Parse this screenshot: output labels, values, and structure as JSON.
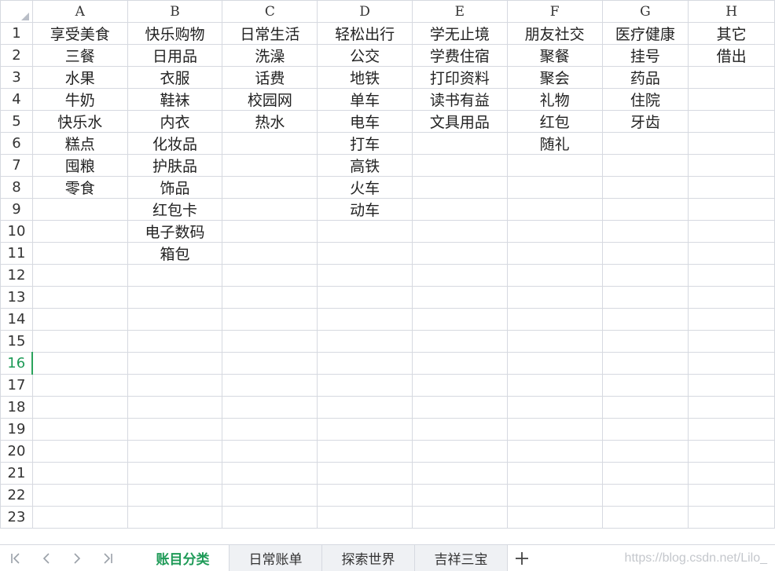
{
  "sheet": {
    "columns": [
      "A",
      "B",
      "C",
      "D",
      "E",
      "F",
      "G",
      "H"
    ],
    "active_row": 16,
    "rows": [
      {
        "num": "1",
        "cells": [
          "享受美食",
          "快乐购物",
          "日常生活",
          "轻松出行",
          "学无止境",
          "朋友社交",
          "医疗健康",
          "其它"
        ]
      },
      {
        "num": "2",
        "cells": [
          "三餐",
          "日用品",
          "洗澡",
          "公交",
          "学费住宿",
          "聚餐",
          "挂号",
          "借出"
        ]
      },
      {
        "num": "3",
        "cells": [
          "水果",
          "衣服",
          "话费",
          "地铁",
          "打印资料",
          "聚会",
          "药品",
          ""
        ]
      },
      {
        "num": "4",
        "cells": [
          "牛奶",
          "鞋袜",
          "校园网",
          "单车",
          "读书有益",
          "礼物",
          "住院",
          ""
        ]
      },
      {
        "num": "5",
        "cells": [
          "快乐水",
          "内衣",
          "热水",
          "电车",
          "文具用品",
          "红包",
          "牙齿",
          ""
        ]
      },
      {
        "num": "6",
        "cells": [
          "糕点",
          "化妆品",
          "",
          "打车",
          "",
          "随礼",
          "",
          ""
        ]
      },
      {
        "num": "7",
        "cells": [
          "囤粮",
          "护肤品",
          "",
          "高铁",
          "",
          "",
          "",
          ""
        ]
      },
      {
        "num": "8",
        "cells": [
          "零食",
          "饰品",
          "",
          "火车",
          "",
          "",
          "",
          ""
        ]
      },
      {
        "num": "9",
        "cells": [
          "",
          "红包卡",
          "",
          "动车",
          "",
          "",
          "",
          ""
        ]
      },
      {
        "num": "10",
        "cells": [
          "",
          "电子数码",
          "",
          "",
          "",
          "",
          "",
          ""
        ]
      },
      {
        "num": "11",
        "cells": [
          "",
          "箱包",
          "",
          "",
          "",
          "",
          "",
          ""
        ]
      },
      {
        "num": "12",
        "cells": [
          "",
          "",
          "",
          "",
          "",
          "",
          "",
          ""
        ]
      },
      {
        "num": "13",
        "cells": [
          "",
          "",
          "",
          "",
          "",
          "",
          "",
          ""
        ]
      },
      {
        "num": "14",
        "cells": [
          "",
          "",
          "",
          "",
          "",
          "",
          "",
          ""
        ]
      },
      {
        "num": "15",
        "cells": [
          "",
          "",
          "",
          "",
          "",
          "",
          "",
          ""
        ]
      },
      {
        "num": "16",
        "cells": [
          "",
          "",
          "",
          "",
          "",
          "",
          "",
          ""
        ]
      },
      {
        "num": "17",
        "cells": [
          "",
          "",
          "",
          "",
          "",
          "",
          "",
          ""
        ]
      },
      {
        "num": "18",
        "cells": [
          "",
          "",
          "",
          "",
          "",
          "",
          "",
          ""
        ]
      },
      {
        "num": "19",
        "cells": [
          "",
          "",
          "",
          "",
          "",
          "",
          "",
          ""
        ]
      },
      {
        "num": "20",
        "cells": [
          "",
          "",
          "",
          "",
          "",
          "",
          "",
          ""
        ]
      },
      {
        "num": "21",
        "cells": [
          "",
          "",
          "",
          "",
          "",
          "",
          "",
          ""
        ]
      },
      {
        "num": "22",
        "cells": [
          "",
          "",
          "",
          "",
          "",
          "",
          "",
          ""
        ]
      },
      {
        "num": "23",
        "cells": [
          "",
          "",
          "",
          "",
          "",
          "",
          "",
          ""
        ]
      }
    ]
  },
  "tabbar": {
    "nav_icons": [
      "first-sheet-icon",
      "prev-sheet-icon",
      "next-sheet-icon",
      "last-sheet-icon"
    ],
    "tabs": [
      {
        "label": "账目分类",
        "active": true
      },
      {
        "label": "日常账单",
        "active": false
      },
      {
        "label": "探索世界",
        "active": false
      },
      {
        "label": "吉祥三宝",
        "active": false
      }
    ],
    "add_icon": "plus-icon",
    "watermark": "https://blog.csdn.net/Lilo_"
  },
  "colors": {
    "accent": "#1e9a57",
    "gridline": "#d6d9e0",
    "tab_inactive_bg": "#eff1f4"
  }
}
